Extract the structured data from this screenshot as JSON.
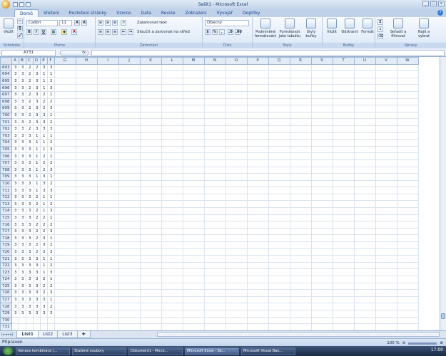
{
  "window": {
    "title": "Sešit1 - Microsoft Excel"
  },
  "ribbon_tabs": [
    "Domů",
    "Vložení",
    "Rozložení stránky",
    "Vzorce",
    "Data",
    "Revize",
    "Zobrazení",
    "Vývojář",
    "Doplňky"
  ],
  "ribbon": {
    "paste_label": "Vložit",
    "clipboard_label": "Schránka",
    "font_name": "Calibri",
    "font_size": "11",
    "font_label": "Písmo",
    "wrap_text": "Zalamovat text",
    "merge_center": "Sloučit a zarovnat na střed",
    "alignment_label": "Zarovnání",
    "number_format": "Obecný",
    "number_label": "Číslo",
    "cond_format": "Podmíněné formátování",
    "format_table": "Formátovat jako tabulku",
    "cell_styles": "Styly buňky",
    "styles_label": "Styly",
    "insert_cells": "Vložit",
    "delete_cells": "Odstranit",
    "format_cells": "Formát",
    "cells_label": "Buňky",
    "sum_symbol": "Σ",
    "sort_filter": "Seřadit a filtrovat",
    "find_select": "Najít a vybrat",
    "editing_label": "Úpravy"
  },
  "formula_bar": {
    "name_box": "A731",
    "fx": "fx",
    "formula": ""
  },
  "columns": [
    "A",
    "B",
    "C",
    "D",
    "E",
    "F",
    "G",
    "H",
    "I",
    "J",
    "K",
    "L",
    "M",
    "N",
    "O",
    "P",
    "Q",
    "R",
    "S",
    "T",
    "U",
    "V",
    "W"
  ],
  "rows": [
    {
      "n": "693",
      "v": [
        "3",
        "3",
        "2",
        "2",
        "3",
        "3"
      ]
    },
    {
      "n": "694",
      "v": [
        "3",
        "3",
        "2",
        "3",
        "1",
        "1"
      ]
    },
    {
      "n": "695",
      "v": [
        "3",
        "3",
        "2",
        "3",
        "1",
        "2"
      ]
    },
    {
      "n": "696",
      "v": [
        "3",
        "3",
        "2",
        "3",
        "1",
        "3"
      ]
    },
    {
      "n": "697",
      "v": [
        "3",
        "3",
        "2",
        "3",
        "2",
        "1"
      ]
    },
    {
      "n": "698",
      "v": [
        "3",
        "3",
        "2",
        "3",
        "2",
        "2"
      ]
    },
    {
      "n": "699",
      "v": [
        "3",
        "3",
        "2",
        "3",
        "2",
        "3"
      ]
    },
    {
      "n": "700",
      "v": [
        "3",
        "3",
        "2",
        "3",
        "3",
        "1"
      ]
    },
    {
      "n": "701",
      "v": [
        "3",
        "3",
        "2",
        "3",
        "3",
        "2"
      ]
    },
    {
      "n": "702",
      "v": [
        "3",
        "3",
        "2",
        "3",
        "3",
        "3"
      ]
    },
    {
      "n": "703",
      "v": [
        "3",
        "3",
        "3",
        "1",
        "1",
        "1"
      ]
    },
    {
      "n": "704",
      "v": [
        "3",
        "3",
        "3",
        "1",
        "1",
        "2"
      ]
    },
    {
      "n": "705",
      "v": [
        "3",
        "3",
        "3",
        "1",
        "1",
        "3"
      ]
    },
    {
      "n": "706",
      "v": [
        "3",
        "3",
        "3",
        "1",
        "2",
        "1"
      ]
    },
    {
      "n": "707",
      "v": [
        "3",
        "3",
        "3",
        "1",
        "2",
        "2"
      ]
    },
    {
      "n": "708",
      "v": [
        "3",
        "3",
        "3",
        "1",
        "2",
        "3"
      ]
    },
    {
      "n": "709",
      "v": [
        "3",
        "3",
        "3",
        "1",
        "3",
        "1"
      ]
    },
    {
      "n": "710",
      "v": [
        "3",
        "3",
        "3",
        "1",
        "3",
        "2"
      ]
    },
    {
      "n": "711",
      "v": [
        "3",
        "3",
        "3",
        "1",
        "3",
        "3"
      ]
    },
    {
      "n": "712",
      "v": [
        "3",
        "3",
        "3",
        "2",
        "1",
        "1"
      ]
    },
    {
      "n": "713",
      "v": [
        "3",
        "3",
        "3",
        "2",
        "1",
        "2"
      ]
    },
    {
      "n": "714",
      "v": [
        "3",
        "3",
        "3",
        "2",
        "1",
        "3"
      ]
    },
    {
      "n": "715",
      "v": [
        "3",
        "3",
        "3",
        "2",
        "2",
        "1"
      ]
    },
    {
      "n": "716",
      "v": [
        "3",
        "3",
        "3",
        "2",
        "2",
        "2"
      ]
    },
    {
      "n": "717",
      "v": [
        "3",
        "3",
        "3",
        "2",
        "2",
        "3"
      ]
    },
    {
      "n": "718",
      "v": [
        "3",
        "3",
        "3",
        "2",
        "3",
        "1"
      ]
    },
    {
      "n": "719",
      "v": [
        "3",
        "3",
        "3",
        "2",
        "3",
        "2"
      ]
    },
    {
      "n": "720",
      "v": [
        "3",
        "3",
        "3",
        "2",
        "3",
        "3"
      ]
    },
    {
      "n": "721",
      "v": [
        "3",
        "3",
        "3",
        "3",
        "1",
        "1"
      ]
    },
    {
      "n": "722",
      "v": [
        "3",
        "3",
        "3",
        "3",
        "1",
        "2"
      ]
    },
    {
      "n": "723",
      "v": [
        "3",
        "3",
        "3",
        "3",
        "1",
        "3"
      ]
    },
    {
      "n": "724",
      "v": [
        "3",
        "3",
        "3",
        "3",
        "2",
        "1"
      ]
    },
    {
      "n": "725",
      "v": [
        "3",
        "3",
        "3",
        "3",
        "2",
        "2"
      ]
    },
    {
      "n": "726",
      "v": [
        "3",
        "3",
        "3",
        "3",
        "2",
        "3"
      ]
    },
    {
      "n": "727",
      "v": [
        "3",
        "3",
        "3",
        "3",
        "3",
        "1"
      ]
    },
    {
      "n": "728",
      "v": [
        "3",
        "3",
        "3",
        "3",
        "3",
        "2"
      ]
    },
    {
      "n": "729",
      "v": [
        "3",
        "3",
        "3",
        "3",
        "3",
        "3"
      ]
    },
    {
      "n": "730",
      "v": [
        "",
        "",
        "",
        "",
        "",
        ""
      ]
    },
    {
      "n": "731",
      "v": [
        "",
        "",
        "",
        "",
        "",
        ""
      ]
    }
  ],
  "sheets": [
    "List1",
    "List2",
    "List3"
  ],
  "status": {
    "text": "Připraven",
    "zoom": "100 %"
  },
  "taskbar": {
    "items": [
      "Variace kombinace |...",
      "Stažené soubory",
      "Dokument1 - Micro...",
      "Microsoft Excel - Se...",
      "Microsoft Visual Bas..."
    ],
    "clock": "17:00"
  }
}
